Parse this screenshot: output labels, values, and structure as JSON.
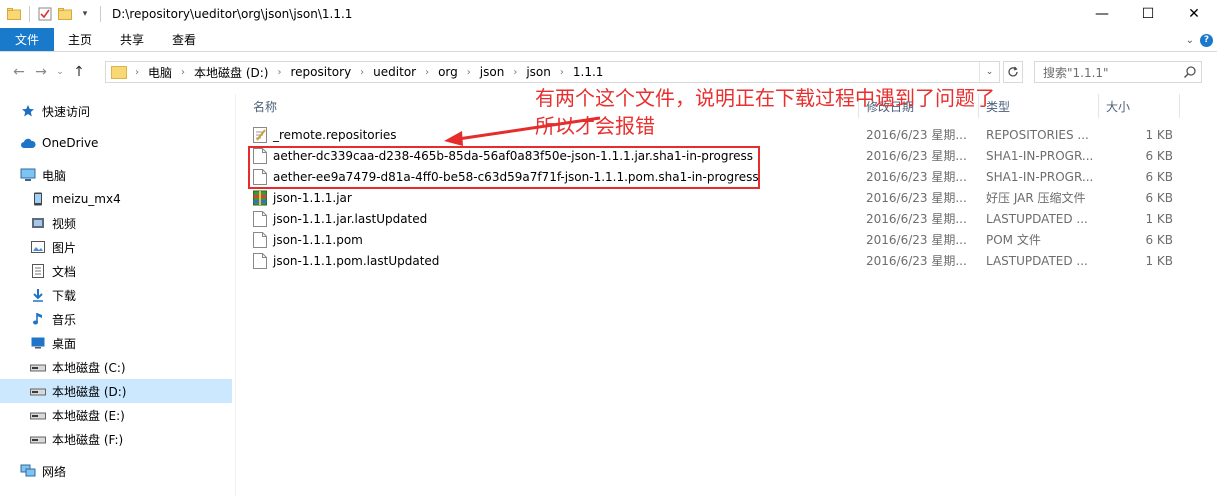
{
  "window": {
    "title": "D:\\repository\\ueditor\\org\\json\\json\\1.1.1",
    "controls": [
      "—",
      "☐",
      "✕"
    ]
  },
  "ribbon": {
    "tabs": [
      "文件",
      "主页",
      "共享",
      "查看"
    ]
  },
  "address": {
    "crumbs": [
      "电脑",
      "本地磁盘 (D:)",
      "repository",
      "ueditor",
      "org",
      "json",
      "json",
      "1.1.1"
    ],
    "search_placeholder": "搜索\"1.1.1\""
  },
  "sidebar": {
    "items": [
      {
        "label": "快速访问",
        "icon": "star-icon",
        "indent": 0
      },
      {
        "label": "OneDrive",
        "icon": "cloud-icon",
        "indent": 0
      },
      {
        "label": "电脑",
        "icon": "computer-icon",
        "indent": 0
      },
      {
        "label": "meizu_mx4",
        "icon": "phone-icon",
        "indent": 1
      },
      {
        "label": "视频",
        "icon": "video-icon",
        "indent": 1
      },
      {
        "label": "图片",
        "icon": "picture-icon",
        "indent": 1
      },
      {
        "label": "文档",
        "icon": "document-icon",
        "indent": 1
      },
      {
        "label": "下载",
        "icon": "download-icon",
        "indent": 1
      },
      {
        "label": "音乐",
        "icon": "music-icon",
        "indent": 1
      },
      {
        "label": "桌面",
        "icon": "desktop-icon",
        "indent": 1
      },
      {
        "label": "本地磁盘 (C:)",
        "icon": "drive-icon",
        "indent": 1
      },
      {
        "label": "本地磁盘 (D:)",
        "icon": "drive-icon",
        "indent": 1,
        "selected": true
      },
      {
        "label": "本地磁盘 (E:)",
        "icon": "drive-icon",
        "indent": 1
      },
      {
        "label": "本地磁盘 (F:)",
        "icon": "drive-icon",
        "indent": 1
      },
      {
        "label": "网络",
        "icon": "network-icon",
        "indent": 0
      }
    ]
  },
  "columns": {
    "name": "名称",
    "date": "修改日期",
    "type": "类型",
    "size": "大小"
  },
  "files": [
    {
      "name": "_remote.repositories",
      "date": "2016/6/23 星期...",
      "type": "REPOSITORIES ...",
      "size": "1 KB",
      "icon": "text-file-icon"
    },
    {
      "name": "aether-dc339caa-d238-465b-85da-56af0a83f50e-json-1.1.1.jar.sha1-in-progress",
      "date": "2016/6/23 星期...",
      "type": "SHA1-IN-PROGR...",
      "size": "6 KB",
      "icon": "blank-file-icon"
    },
    {
      "name": "aether-ee9a7479-d81a-4ff0-be58-c63d59a7f71f-json-1.1.1.pom.sha1-in-progress",
      "date": "2016/6/23 星期...",
      "type": "SHA1-IN-PROGR...",
      "size": "6 KB",
      "icon": "blank-file-icon"
    },
    {
      "name": "json-1.1.1.jar",
      "date": "2016/6/23 星期...",
      "type": "好压 JAR 压缩文件",
      "size": "6 KB",
      "icon": "archive-icon"
    },
    {
      "name": "json-1.1.1.jar.lastUpdated",
      "date": "2016/6/23 星期...",
      "type": "LASTUPDATED ...",
      "size": "1 KB",
      "icon": "blank-file-icon"
    },
    {
      "name": "json-1.1.1.pom",
      "date": "2016/6/23 星期...",
      "type": "POM 文件",
      "size": "6 KB",
      "icon": "blank-file-icon"
    },
    {
      "name": "json-1.1.1.pom.lastUpdated",
      "date": "2016/6/23 星期...",
      "type": "LASTUPDATED ...",
      "size": "1 KB",
      "icon": "blank-file-icon"
    }
  ],
  "annotation": {
    "line1": "有两个这个文件，说明正在下载过程中遇到了问题了",
    "line2": "所以才会报错",
    "color": "#e8302f"
  }
}
